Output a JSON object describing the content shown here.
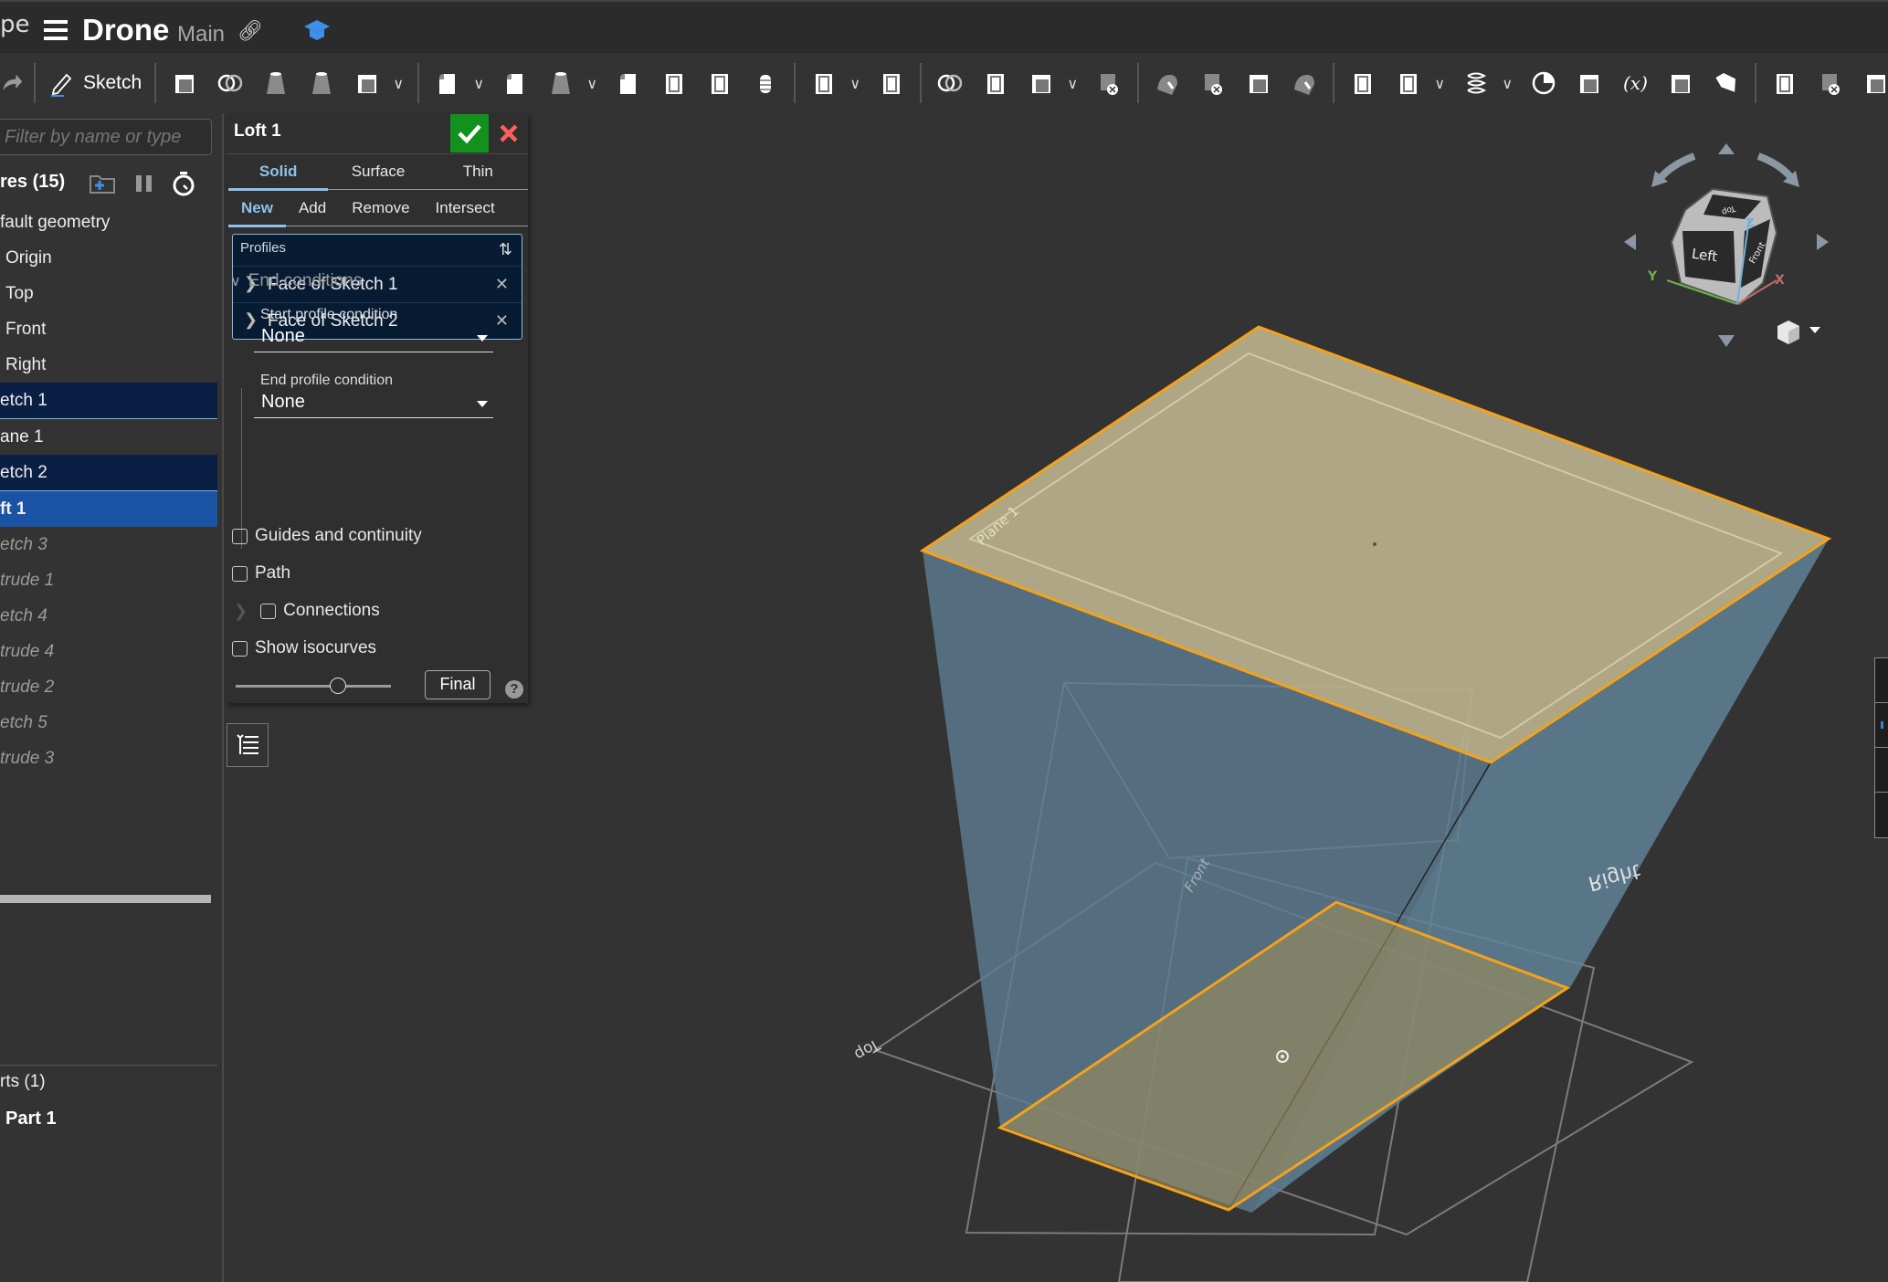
{
  "header": {
    "breadcrumb_fragment": "pe",
    "menu_icon": "hamburger-menu-icon",
    "document_title": "Drone",
    "branch": "Main",
    "link_icon": "link-icon",
    "learning_icon": "graduation-cap-icon"
  },
  "toolbar": {
    "redo_icon": "redo-icon",
    "sketch_label": "Sketch",
    "tools": [
      "extrude-icon",
      "revolve-icon",
      "sweep-icon",
      "loft-icon",
      "thicken-icon",
      "fillet-icon",
      "chamfer-icon",
      "draft-icon",
      "rib-icon",
      "shell-icon",
      "hole-icon",
      "thread-icon",
      "linear-pattern-icon",
      "mirror-icon",
      "boolean-icon",
      "split-icon",
      "transform-icon",
      "delete-part-icon",
      "modify-fillet-icon",
      "delete-face-icon",
      "move-face-icon",
      "replace-face-icon",
      "plane-icon",
      "mate-connector-icon",
      "helix-icon",
      "mass-properties-icon",
      "derived-icon",
      "variable-icon",
      "configuration-icon",
      "tag-icon",
      "sheet-metal-icon",
      "sheet-metal-remove-icon",
      "more-icon"
    ]
  },
  "sidebar": {
    "filter_placeholder": "Filter by name or type",
    "features_label": "res (15)",
    "items": [
      {
        "label": "fault geometry",
        "state": "normal"
      },
      {
        "label": "Origin",
        "state": "normal"
      },
      {
        "label": "Top",
        "state": "normal"
      },
      {
        "label": "Front",
        "state": "normal"
      },
      {
        "label": "Right",
        "state": "normal"
      },
      {
        "label": "etch 1",
        "state": "selected"
      },
      {
        "label": "ane 1",
        "state": "normal"
      },
      {
        "label": "etch 2",
        "state": "selected"
      },
      {
        "label": "ft 1",
        "state": "active"
      },
      {
        "label": "etch 3",
        "state": "rolled"
      },
      {
        "label": "trude 1",
        "state": "rolled"
      },
      {
        "label": "etch 4",
        "state": "rolled"
      },
      {
        "label": "trude 4",
        "state": "rolled"
      },
      {
        "label": "trude 2",
        "state": "rolled"
      },
      {
        "label": "etch 5",
        "state": "rolled"
      },
      {
        "label": "trude 3",
        "state": "rolled"
      }
    ],
    "parts_label": "rts (1)",
    "part_name": "Part 1"
  },
  "loft_panel": {
    "title": "Loft 1",
    "body_tabs": [
      "Solid",
      "Surface",
      "Thin"
    ],
    "active_body_tab": "Solid",
    "op_tabs": [
      "New",
      "Add",
      "Remove",
      "Intersect"
    ],
    "active_op_tab": "New",
    "profiles_label": "Profiles",
    "profiles": [
      "Face of Sketch 1",
      "Face of Sketch 2"
    ],
    "end_conditions_label": "End conditions",
    "start_condition_label": "Start profile condition",
    "start_condition_value": "None",
    "end_condition_label": "End profile condition",
    "end_condition_value": "None",
    "guides_label": "Guides and continuity",
    "guides_checked": false,
    "path_label": "Path",
    "path_checked": false,
    "connections_label": "Connections",
    "connections_checked": false,
    "isocurves_label": "Show isocurves",
    "isocurves_checked": false,
    "preview_slider_fraction": 0.65,
    "final_label": "Final",
    "help_glyph": "?"
  },
  "viewport": {
    "plane_labels": [
      "Plane 1",
      "Front",
      "Right",
      "Top"
    ],
    "viewcube": {
      "faces": [
        "Left",
        "Front",
        "Top"
      ],
      "axes": [
        "X",
        "Y",
        "Z"
      ]
    },
    "colors": {
      "selection": "#f5a21b",
      "part": "#5e7d92",
      "face_highlight": "#b5ad8a",
      "background": "#333333"
    }
  }
}
